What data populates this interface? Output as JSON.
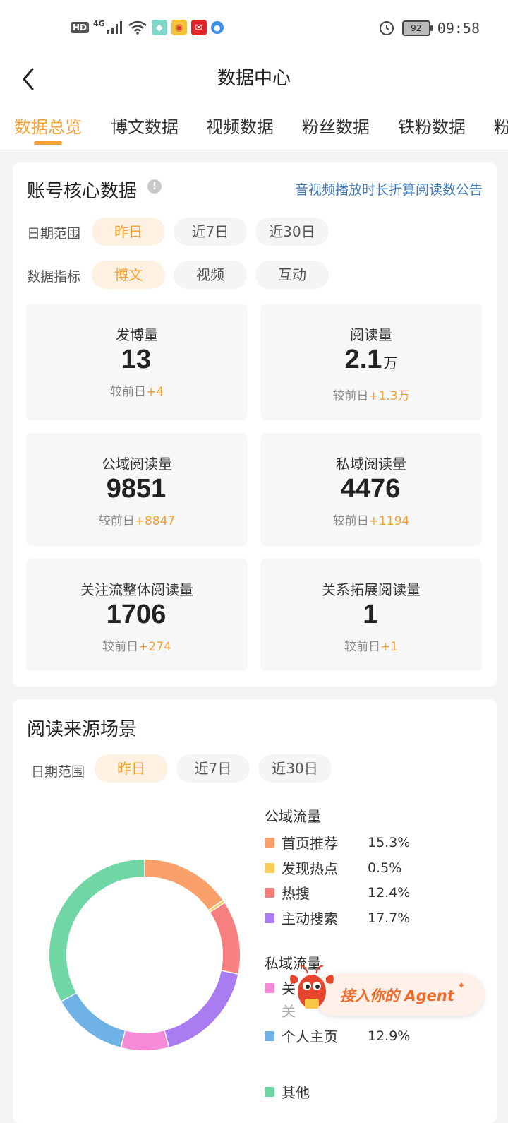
{
  "status_bar": {
    "hd": "HD",
    "network": "4G",
    "battery": "92",
    "time": "09:58"
  },
  "header": {
    "title": "数据中心"
  },
  "tabs": [
    {
      "label": "数据总览",
      "active": true
    },
    {
      "label": "博文数据",
      "active": false
    },
    {
      "label": "视频数据",
      "active": false
    },
    {
      "label": "粉丝数据",
      "active": false
    },
    {
      "label": "铁粉数据",
      "active": false
    },
    {
      "label": "粉",
      "active": false
    }
  ],
  "core": {
    "title": "账号核心数据",
    "notice_link": "音视频播放时长折算阅读数公告",
    "date_label": "日期范围",
    "date_options": [
      "昨日",
      "近7日",
      "近30日"
    ],
    "metric_label": "数据指标",
    "metric_options": [
      "博文",
      "视频",
      "互动"
    ],
    "compare_prefix": "较前日",
    "stats": [
      {
        "label": "发博量",
        "value": "13",
        "unit": "",
        "delta": "+4"
      },
      {
        "label": "阅读量",
        "value": "2.1",
        "unit": "万",
        "delta": "+1.3万"
      },
      {
        "label": "公域阅读量",
        "value": "9851",
        "unit": "",
        "delta": "+8847"
      },
      {
        "label": "私域阅读量",
        "value": "4476",
        "unit": "",
        "delta": "+1194"
      },
      {
        "label": "关注流整体阅读量",
        "value": "1706",
        "unit": "",
        "delta": "+274"
      },
      {
        "label": "关系拓展阅读量",
        "value": "1",
        "unit": "",
        "delta": "+1"
      }
    ]
  },
  "source": {
    "title": "阅读来源场景",
    "date_label": "日期范围",
    "date_options": [
      "昨日",
      "近7日",
      "近30日"
    ],
    "public_group": "公域流量",
    "private_group": "私域流量",
    "legend": [
      {
        "label": "首页推荐",
        "pct": "15.3%",
        "color": "#f9a06b"
      },
      {
        "label": "发现热点",
        "pct": "0.5%",
        "color": "#f9cd5a"
      },
      {
        "label": "热搜",
        "pct": "12.4%",
        "color": "#f67f7f"
      },
      {
        "label": "主动搜索",
        "pct": "17.7%",
        "color": "#a97cf2"
      },
      {
        "label": "关",
        "pct": "",
        "color": "#f58bd8"
      },
      {
        "label": "关",
        "pct": "",
        "color": ""
      },
      {
        "label": "个人主页",
        "pct": "12.9%",
        "color": "#6fb2e6"
      },
      {
        "label": "其他",
        "pct": "",
        "color": "#6fd6a4"
      }
    ]
  },
  "chart_data": {
    "type": "pie",
    "title": "",
    "donut": true,
    "slices": [
      {
        "name": "首页推荐",
        "value": 15.3,
        "color": "#f9a06b"
      },
      {
        "name": "发现热点",
        "value": 0.5,
        "color": "#f9cd5a"
      },
      {
        "name": "热搜",
        "value": 12.4,
        "color": "#f67f7f"
      },
      {
        "name": "主动搜索",
        "value": 17.7,
        "color": "#a97cf2"
      },
      {
        "name": "关",
        "value": 8.1,
        "color": "#f58bd8"
      },
      {
        "name": "个人主页",
        "value": 12.9,
        "color": "#6fb2e6"
      },
      {
        "name": "其他",
        "value": 33.1,
        "color": "#6fd6a4"
      }
    ]
  },
  "agent": {
    "label": "接入你的 Agent"
  }
}
